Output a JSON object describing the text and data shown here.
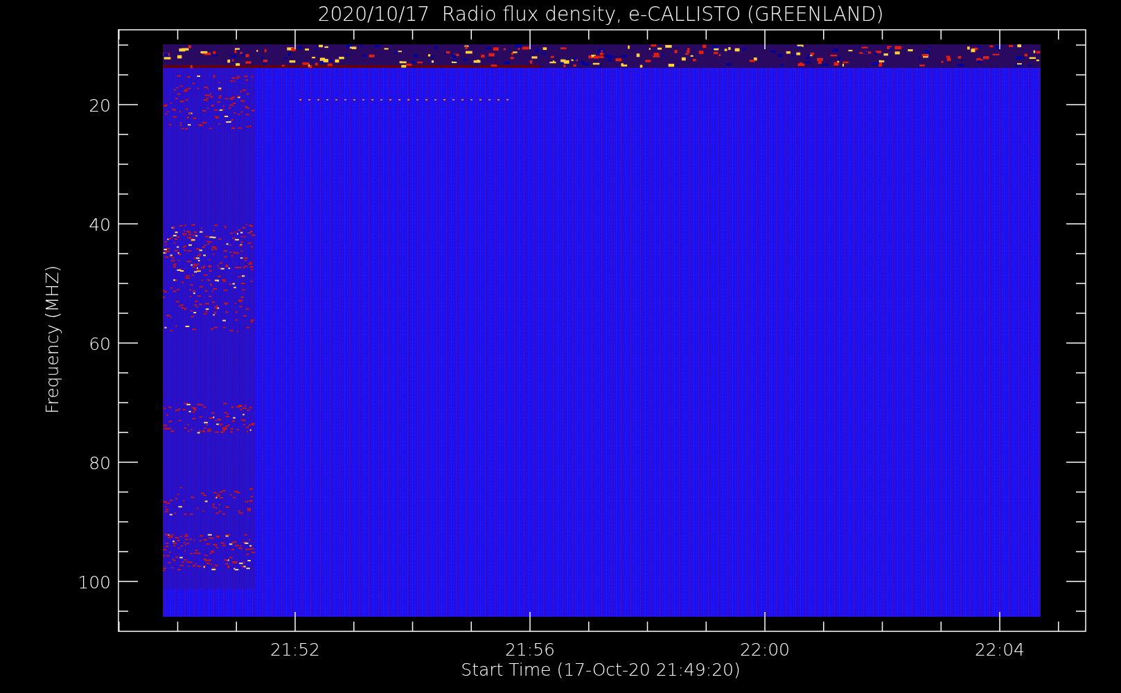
{
  "title": "2020/10/17  Radio flux density, e-CALLISTO (GREENLAND)",
  "y_axis": {
    "label": "Frequency (MHZ)",
    "ticks": [
      "20",
      "40",
      "60",
      "80",
      "100"
    ]
  },
  "x_axis": {
    "label": "Start Time (17-Oct-20 21:49:20)",
    "ticks": [
      "21:52",
      "21:56",
      "22:00",
      "22:04"
    ]
  }
}
